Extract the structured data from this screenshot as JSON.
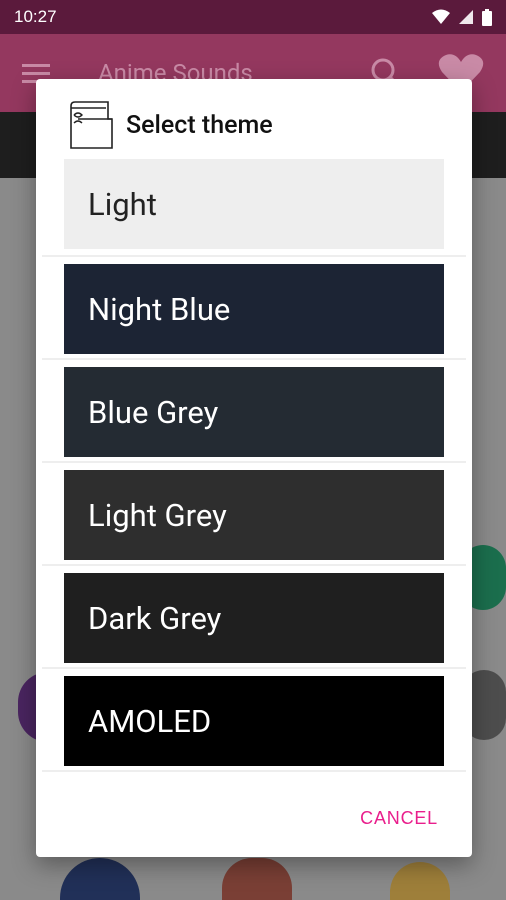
{
  "status_bar": {
    "time": "10:27"
  },
  "app_bar": {
    "title": "Anime Sounds"
  },
  "dialog": {
    "title": "Select theme",
    "options": [
      {
        "label": "Light",
        "bg": "#eeeeee",
        "fg": "#222222"
      },
      {
        "label": "Night Blue",
        "bg": "#1c2434",
        "fg": "#ffffff"
      },
      {
        "label": "Blue Grey",
        "bg": "#242b33",
        "fg": "#ffffff"
      },
      {
        "label": "Light Grey",
        "bg": "#2e2e2e",
        "fg": "#ffffff"
      },
      {
        "label": "Dark Grey",
        "bg": "#1f1f1f",
        "fg": "#ffffff"
      },
      {
        "label": "AMOLED",
        "bg": "#000000",
        "fg": "#ffffff"
      }
    ],
    "cancel_label": "CANCEL"
  },
  "colors": {
    "accent": "#e91e8c",
    "primary_dark": "#5b1a3c",
    "primary": "#94385f"
  }
}
